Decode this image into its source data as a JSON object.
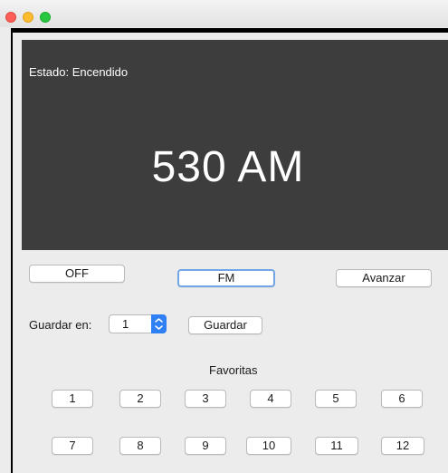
{
  "window": {
    "controls": [
      "close",
      "minimize",
      "zoom"
    ]
  },
  "display": {
    "status": "Estado: Encendido",
    "frequency": "530 AM"
  },
  "controls": {
    "power_label": "OFF",
    "band_label": "FM",
    "advance_label": "Avanzar"
  },
  "save": {
    "label": "Guardar en:",
    "slot_value": "1",
    "button_label": "Guardar"
  },
  "favorites": {
    "title": "Favoritas",
    "row1": [
      "1",
      "2",
      "3",
      "4",
      "5",
      "6"
    ],
    "row2": [
      "7",
      "8",
      "9",
      "10",
      "11",
      "12"
    ]
  },
  "colors": {
    "display_bg": "#3d3d3d",
    "accent": "#2f7ff5",
    "focus_ring": "#74a5e6"
  }
}
